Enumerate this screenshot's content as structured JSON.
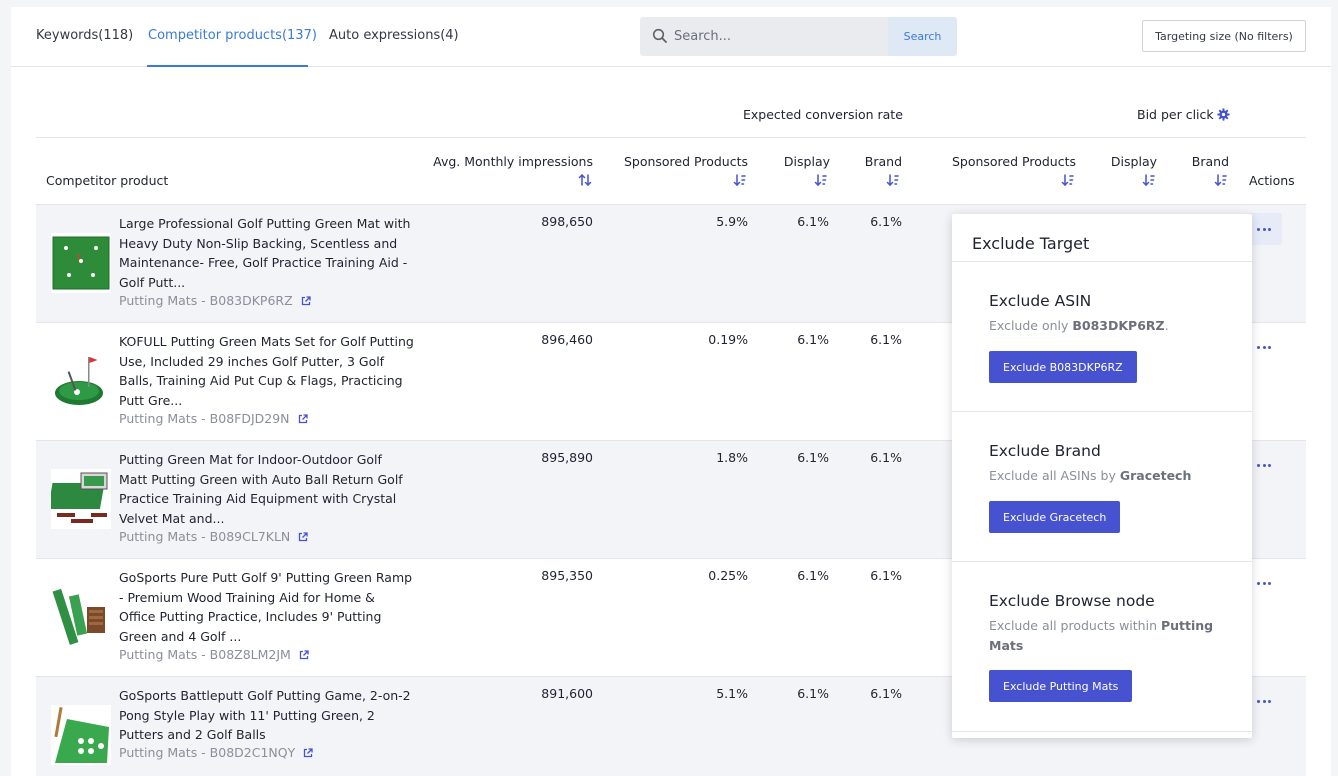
{
  "tabs": [
    {
      "label": "Keywords(118)",
      "active": false
    },
    {
      "label": "Competitor products(137)",
      "active": true
    },
    {
      "label": "Auto expressions(4)",
      "active": false
    }
  ],
  "search": {
    "placeholder": "Search...",
    "button_label": "Search",
    "icon": "search-icon"
  },
  "targeting_size_label": "Targeting size (No filters)",
  "table": {
    "group_headers": {
      "conversion": "Expected conversion rate",
      "bid": "Bid per click"
    },
    "columns": {
      "product": "Competitor product",
      "impressions": "Avg. Monthly impressions",
      "sp_conv": "Sponsored Products",
      "display_conv": "Display",
      "brand_conv": "Brand",
      "sp_bid": "Sponsored Products",
      "display_bid": "Display",
      "brand_bid": "Brand",
      "actions": "Actions"
    },
    "rows": [
      {
        "title": "Large Professional Golf Putting Green Mat with Heavy Duty Non-Slip Backing, Scentless and Maintenance- Free, Golf Practice Training Aid - Golf Putt...",
        "meta": "Putting Mats - B083DKP6RZ",
        "impressions": "898,650",
        "sp": "5.9%",
        "display": "6.1%",
        "brand": "6.1%"
      },
      {
        "title": "KOFULL Putting Green Mats Set for Golf Putting Use, Included 29 inches Golf Putter, 3 Golf Balls, Training Aid Put Cup & Flags, Practicing Putt Gre...",
        "meta": "Putting Mats - B08FDJD29N",
        "impressions": "896,460",
        "sp": "0.19%",
        "display": "6.1%",
        "brand": "6.1%"
      },
      {
        "title": "Putting Green Mat for Indoor-Outdoor Golf Matt Putting Green with Auto Ball Return Golf Practice Training Aid Equipment with Crystal Velvet Mat and...",
        "meta": "Putting Mats - B089CL7KLN",
        "impressions": "895,890",
        "sp": "1.8%",
        "display": "6.1%",
        "brand": "6.1%"
      },
      {
        "title": "GoSports Pure Putt Golf 9' Putting Green Ramp - Premium Wood Training Aid for Home & Office Putting Practice, Includes 9' Putting Green and 4 Golf ...",
        "meta": "Putting Mats - B08Z8LM2JM",
        "impressions": "895,350",
        "sp": "0.25%",
        "display": "6.1%",
        "brand": "6.1%"
      },
      {
        "title": "GoSports Battleputt Golf Putting Game, 2-on-2 Pong Style Play with 11' Putting Green, 2 Putters and 2 Golf Balls",
        "meta": "Putting Mats - B08D2C1NQY",
        "impressions": "891,600",
        "sp": "5.1%",
        "display": "6.1%",
        "brand": "6.1%"
      }
    ]
  },
  "popover": {
    "title": "Exclude Target",
    "sections": [
      {
        "title": "Exclude ASIN",
        "desc_prefix": "Exclude only ",
        "desc_bold": "B083DKP6RZ",
        "desc_suffix": ".",
        "button": "Exclude B083DKP6RZ"
      },
      {
        "title": "Exclude Brand",
        "desc_prefix": "Exclude all ASINs by ",
        "desc_bold": "Gracetech",
        "desc_suffix": "",
        "button": "Exclude Gracetech"
      },
      {
        "title": "Exclude Browse node",
        "desc_prefix": "Exclude all products within ",
        "desc_bold": "Putting Mats",
        "desc_suffix": "",
        "button": "Exclude Putting Mats"
      }
    ]
  },
  "colors": {
    "accent": "#3a7bd5",
    "button": "#4652cf",
    "row_alt": "#f3f4f7"
  }
}
